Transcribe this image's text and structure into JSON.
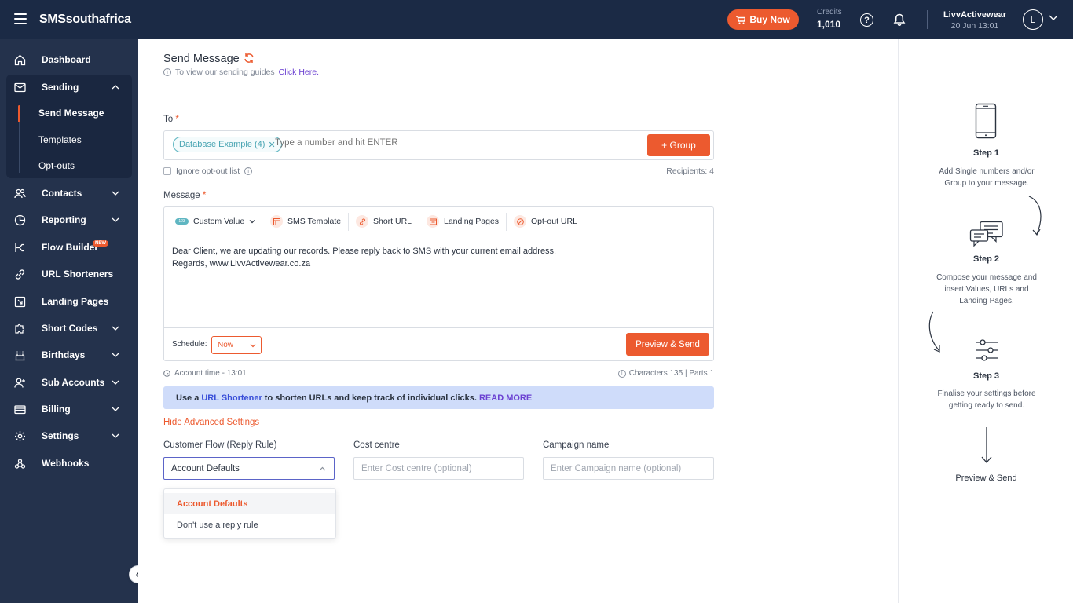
{
  "app": {
    "logo": "SMSsouthafrica"
  },
  "header": {
    "buy_now": "Buy Now",
    "credits_label": "Credits",
    "credits_value": "1,010",
    "account_name": "LivvActivewear",
    "account_date": "20 Jun 13:01",
    "avatar_letter": "L"
  },
  "sidebar": {
    "dashboard": "Dashboard",
    "sending": "Sending",
    "send_message": "Send Message",
    "templates": "Templates",
    "opt_outs": "Opt-outs",
    "contacts": "Contacts",
    "reporting": "Reporting",
    "flow_builder": "Flow Builder",
    "new_badge": "NEW",
    "url_shorteners": "URL Shorteners",
    "landing_pages": "Landing Pages",
    "short_codes": "Short Codes",
    "birthdays": "Birthdays",
    "sub_accounts": "Sub Accounts",
    "billing": "Billing",
    "settings": "Settings",
    "webhooks": "Webhooks"
  },
  "page": {
    "title": "Send Message",
    "guide_text": "To view our sending guides",
    "guide_link": "Click Here."
  },
  "to": {
    "label": "To",
    "required": "*",
    "chip": "Database Example (4)",
    "placeholder": "Type a number and hit ENTER",
    "group_btn": "+ Group",
    "ignore_label": "Ignore opt-out list",
    "recipients": "Recipients: 4"
  },
  "message": {
    "label": "Message",
    "required": "*",
    "toolbar": {
      "custom_value_badge": "123",
      "custom_value": "Custom Value",
      "sms_template": "SMS Template",
      "short_url": "Short URL",
      "landing_pages": "Landing Pages",
      "optout_url": "Opt-out URL"
    },
    "text": "Dear Client, we are updating our records. Please reply back to SMS with your current email address.\nRegards, www.LivvActivewear.co.za",
    "schedule_label": "Schedule:",
    "schedule_value": "Now",
    "preview_btn": "Preview & Send",
    "account_time": "Account time - 13:01",
    "chars": "Characters 135 | Parts 1"
  },
  "banner": {
    "pre": "Use a",
    "link": "URL Shortener",
    "mid": "to shorten URLs and keep track of individual clicks.",
    "read_more": "READ MORE"
  },
  "advanced": {
    "toggle": "Hide Advanced Settings",
    "customer_flow_label": "Customer Flow (Reply Rule)",
    "customer_flow_value": "Account Defaults",
    "cost_centre_label": "Cost centre",
    "cost_centre_placeholder": "Enter Cost centre (optional)",
    "campaign_label": "Campaign name",
    "campaign_placeholder": "Enter Campaign name (optional)",
    "options": [
      "Account Defaults",
      "Don't use a reply rule"
    ]
  },
  "steps": {
    "s1_title": "Step 1",
    "s1_desc": "Add Single numbers and/or Group to your message.",
    "s2_title": "Step 2",
    "s2_desc": "Compose your message and insert Values, URLs and Landing Pages.",
    "s3_title": "Step 3",
    "s3_desc": "Finalise your settings before getting ready to send.",
    "final": "Preview & Send"
  },
  "colors": {
    "accent": "#ec5a2f",
    "navy": "#1b2a45",
    "sidebar": "#24324c"
  }
}
